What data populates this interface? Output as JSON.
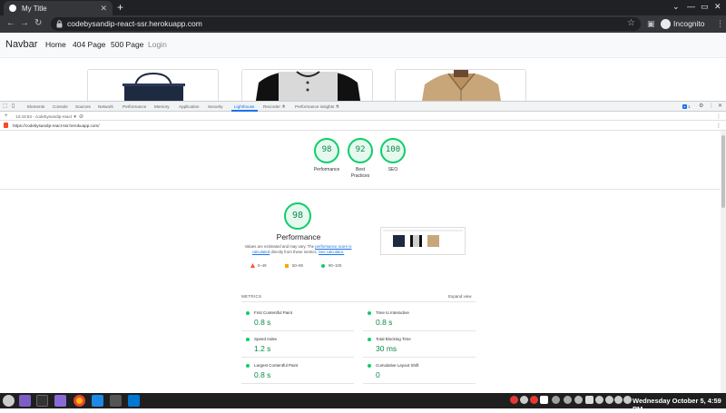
{
  "browser": {
    "tab_title": "My Title",
    "new_tab": "+",
    "url": "codebysandip-react-ssr.herokuapp.com",
    "mode_label": "Incognito"
  },
  "site": {
    "brand": "Navbar",
    "links": [
      "Home",
      "404 Page",
      "500 Page",
      "Login"
    ]
  },
  "devtools": {
    "tabs": [
      "Elements",
      "Console",
      "Sources",
      "Network",
      "Performance",
      "Memory",
      "Application",
      "Security",
      "Lighthouse",
      "Recorder ⚗",
      "Performance insights ⚗"
    ],
    "active_tab": "Lighthouse",
    "issues_count": "1",
    "report_selector": "13:43:53 - codebysandip-react ▼",
    "report_url": "https://codebysandip-react-ssr.herokuapp.com/"
  },
  "lighthouse": {
    "summary": [
      {
        "score": "98",
        "label": "Performance"
      },
      {
        "score": "92",
        "label": "Best Practices"
      },
      {
        "score": "100",
        "label": "SEO"
      }
    ],
    "performance": {
      "score": "98",
      "title": "Performance",
      "note_1": "Values are estimated and may vary. The",
      "note_link_1": "performance score is calculated",
      "note_2": "directly from these metrics.",
      "note_link_2": "See calculator.",
      "legend": [
        {
          "range": "0–49",
          "color": "#ff4e42"
        },
        {
          "range": "50–89",
          "color": "#ffa400"
        },
        {
          "range": "90–100",
          "color": "#0cce6b"
        }
      ]
    },
    "metrics_header": "METRICS",
    "expand_label": "Expand view",
    "metrics": [
      {
        "name": "First Contentful Paint",
        "value": "0.8 s"
      },
      {
        "name": "Time to Interactive",
        "value": "0.8 s"
      },
      {
        "name": "Speed Index",
        "value": "1.2 s"
      },
      {
        "name": "Total Blocking Time",
        "value": "30 ms"
      },
      {
        "name": "Largest Contentful Paint",
        "value": "0.8 s"
      },
      {
        "name": "Cumulative Layout Shift",
        "value": "0"
      }
    ]
  },
  "taskbar": {
    "clock": "Wednesday October  5, 4:59 PM"
  },
  "colors": {
    "good": "#0cce6b",
    "good_text": "#0a8a48",
    "link": "#1a73e8"
  }
}
